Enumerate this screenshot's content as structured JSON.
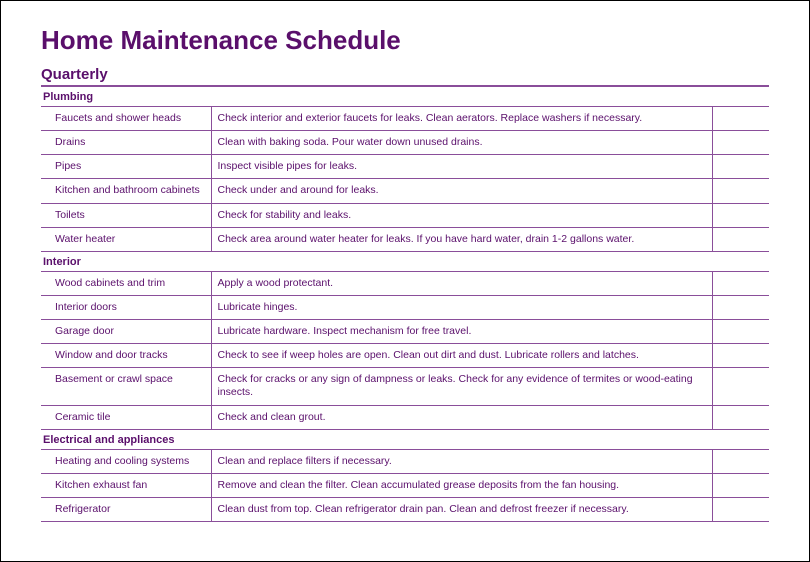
{
  "title": "Home Maintenance Schedule",
  "subtitle": "Quarterly",
  "sections": [
    {
      "heading": "Plumbing",
      "rows": [
        {
          "item": "Faucets and shower heads",
          "task": "Check interior and exterior faucets for leaks. Clean aerators. Replace washers if necessary."
        },
        {
          "item": "Drains",
          "task": "Clean with baking soda. Pour water down unused drains."
        },
        {
          "item": "Pipes",
          "task": "Inspect visible pipes for leaks."
        },
        {
          "item": "Kitchen and bathroom cabinets",
          "task": "Check under and around for leaks."
        },
        {
          "item": "Toilets",
          "task": "Check for stability and leaks."
        },
        {
          "item": "Water heater",
          "task": "Check area around water heater for leaks. If you have hard water, drain 1-2 gallons water."
        }
      ]
    },
    {
      "heading": "Interior",
      "rows": [
        {
          "item": "Wood cabinets and trim",
          "task": "Apply a wood protectant."
        },
        {
          "item": "Interior doors",
          "task": "Lubricate hinges."
        },
        {
          "item": "Garage door",
          "task": "Lubricate hardware. Inspect mechanism for free travel."
        },
        {
          "item": "Window and door tracks",
          "task": "Check to see if weep holes are open. Clean out dirt and dust. Lubricate rollers and latches."
        },
        {
          "item": "Basement or crawl space",
          "task": "Check for cracks or any sign of dampness or leaks. Check for any evidence of termites or wood-eating insects."
        },
        {
          "item": "Ceramic tile",
          "task": "Check and clean grout."
        }
      ]
    },
    {
      "heading": "Electrical and appliances",
      "rows": [
        {
          "item": "Heating and cooling systems",
          "task": "Clean and replace filters if necessary."
        },
        {
          "item": "Kitchen exhaust fan",
          "task": "Remove and clean the filter. Clean accumulated grease deposits from the fan housing."
        },
        {
          "item": "Refrigerator",
          "task": "Clean dust from top. Clean refrigerator drain pan. Clean and defrost freezer if necessary."
        }
      ]
    }
  ]
}
